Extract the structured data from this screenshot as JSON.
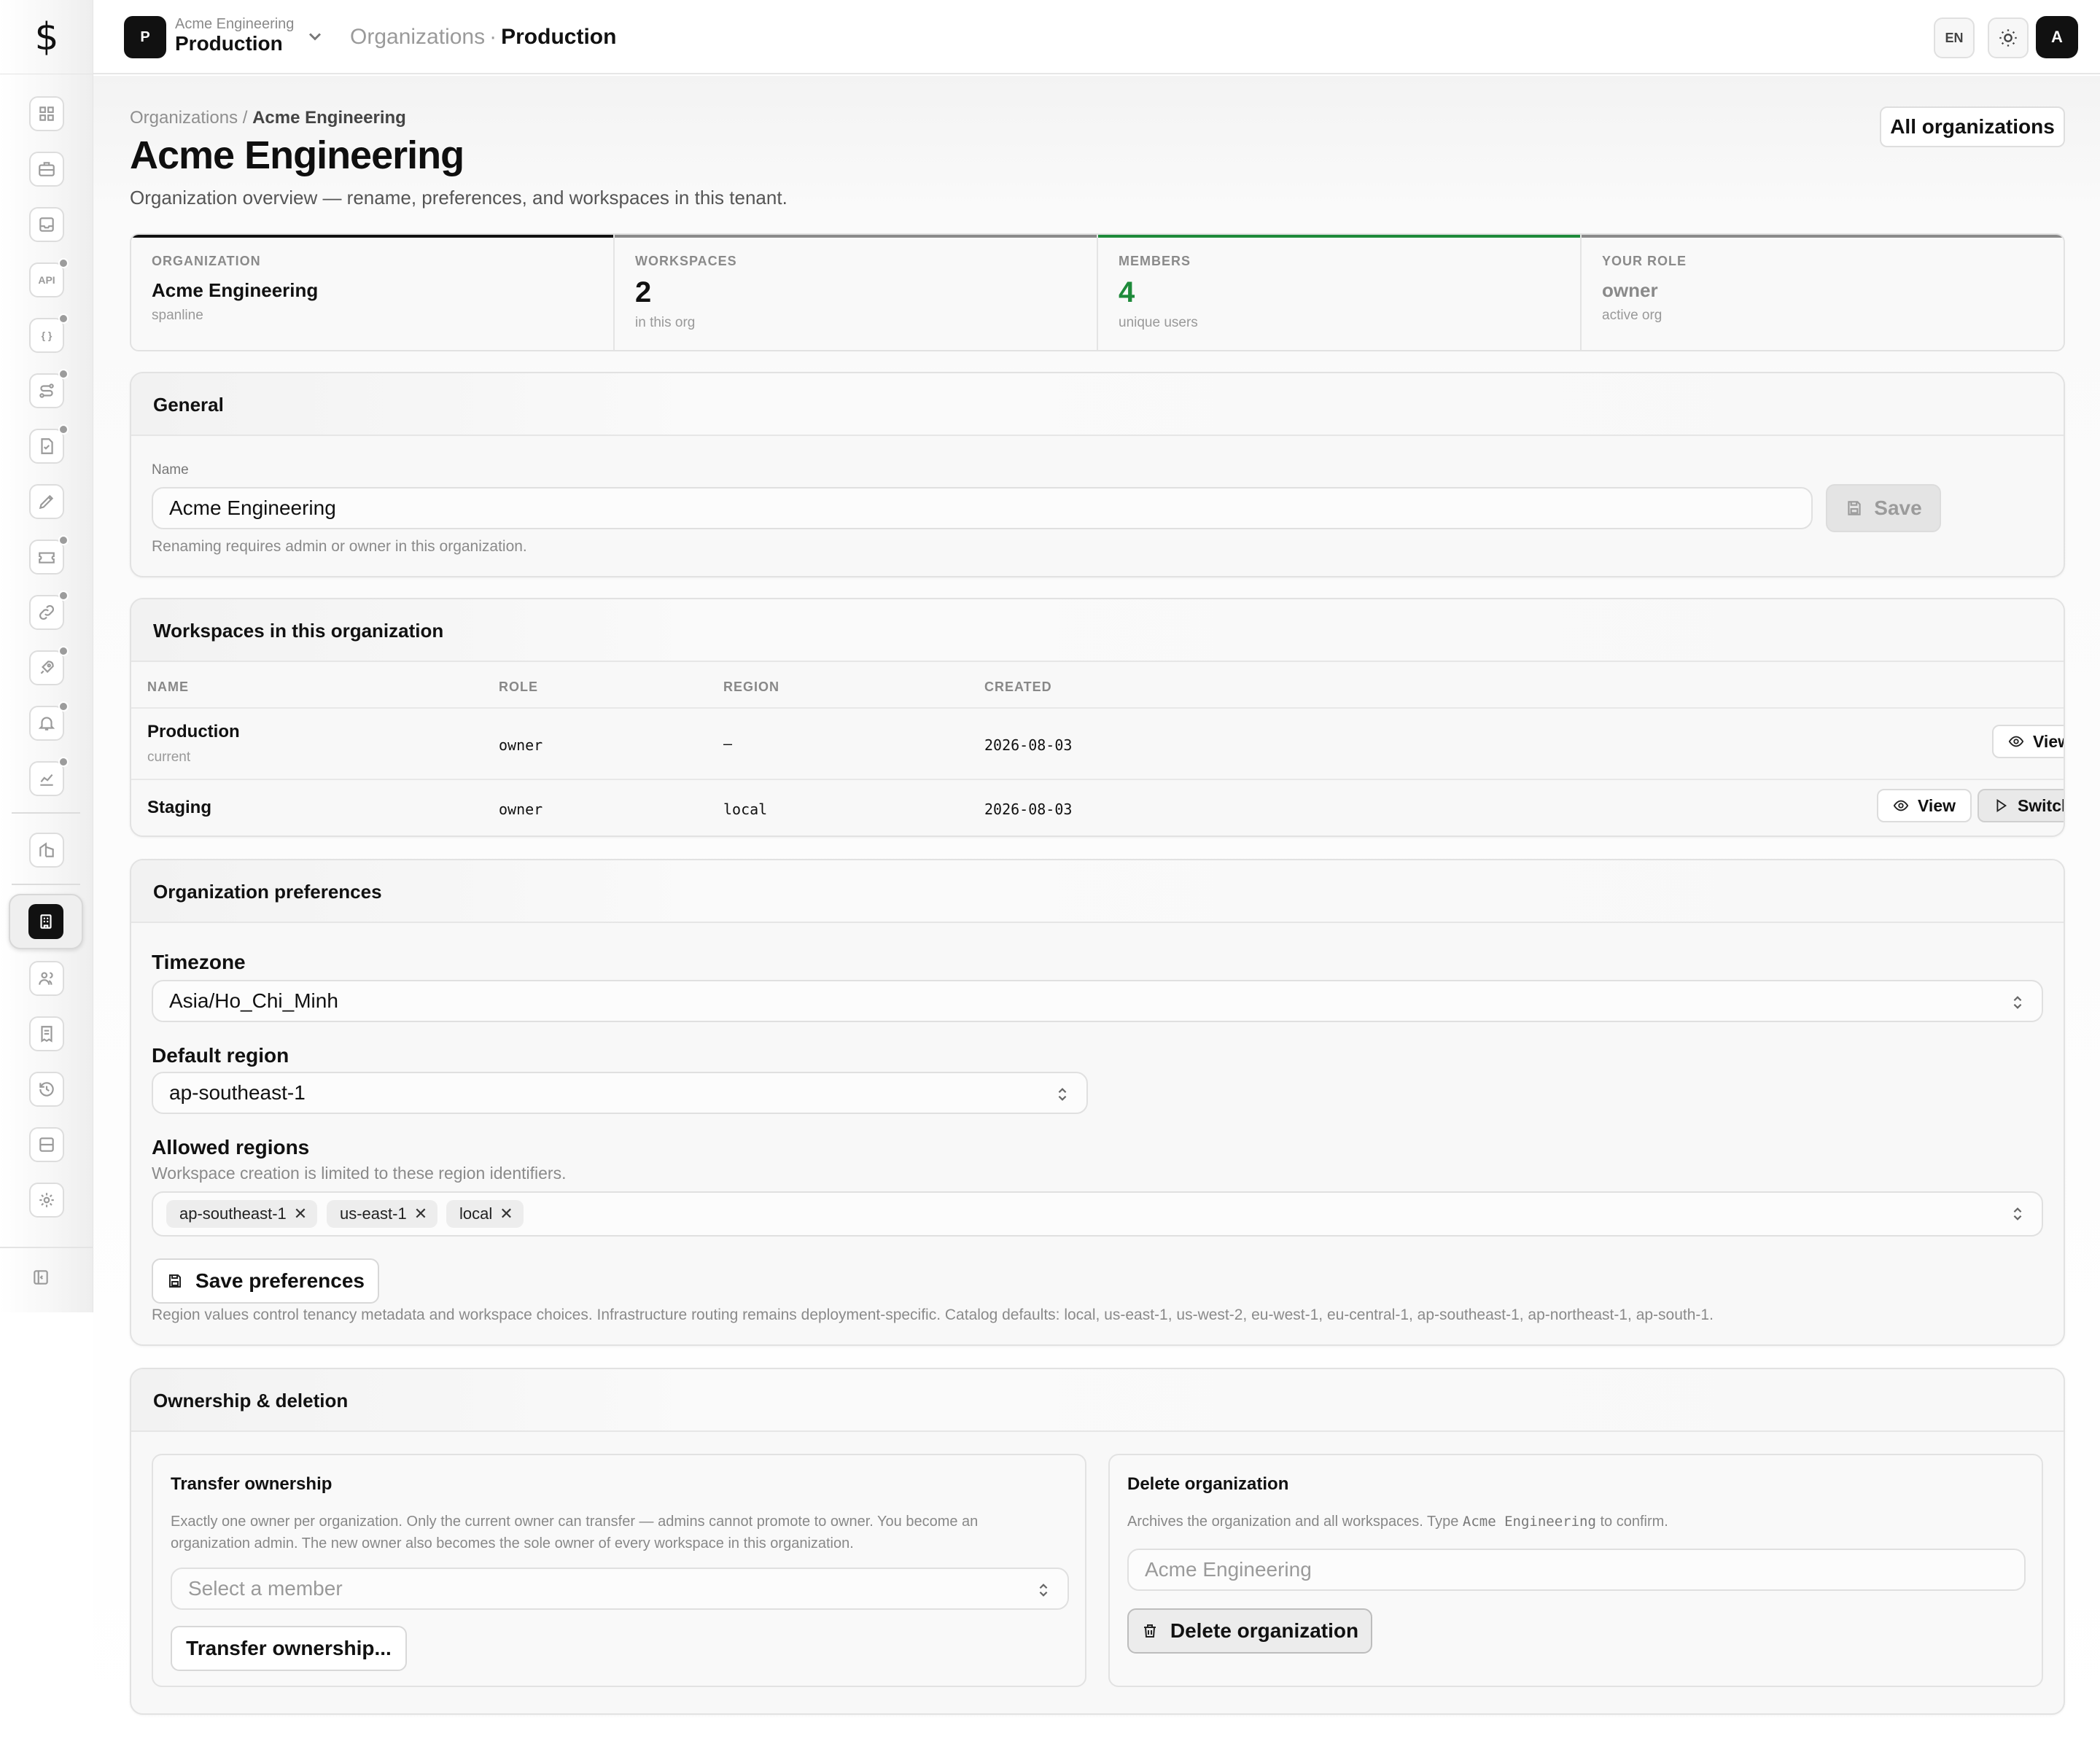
{
  "sidebar": {
    "logo": "$",
    "items": [
      {
        "icon": "dashboard-icon",
        "dot": false
      },
      {
        "icon": "briefcase-icon",
        "dot": false
      },
      {
        "icon": "inbox-icon",
        "dot": false
      },
      {
        "icon": "api-icon",
        "label": "API",
        "dot": true
      },
      {
        "icon": "braces-icon",
        "label": "{ }",
        "dot": true
      },
      {
        "icon": "route-icon",
        "dot": true
      },
      {
        "icon": "document-check-icon",
        "dot": true
      },
      {
        "icon": "pen-icon",
        "dot": false
      },
      {
        "icon": "ticket-icon",
        "dot": true
      },
      {
        "icon": "link-icon",
        "dot": true
      },
      {
        "icon": "rocket-icon",
        "dot": true
      },
      {
        "icon": "bell-icon",
        "dot": true
      },
      {
        "icon": "chart-icon",
        "dot": true
      },
      {
        "icon": "building-icon",
        "dot": false
      },
      {
        "icon": "organization-icon",
        "active": true
      },
      {
        "icon": "users-icon",
        "dot": false
      },
      {
        "icon": "receipt-icon",
        "dot": false
      },
      {
        "icon": "history-icon",
        "dot": false
      },
      {
        "icon": "storage-icon",
        "dot": false
      },
      {
        "icon": "settings-icon",
        "dot": false
      },
      {
        "icon": "collapse-sidebar-icon",
        "dot": false
      }
    ]
  },
  "topbar": {
    "workspace_avatar": "P",
    "workspace_org": "Acme Engineering",
    "workspace_name": "Production",
    "crumb_parent": "Organizations",
    "crumb_separator": "·",
    "crumb_current": "Production",
    "language": "EN",
    "user_initial": "A"
  },
  "page": {
    "breadcrumb_parent": "Organizations",
    "breadcrumb_separator": "/",
    "breadcrumb_current": "Acme Engineering",
    "title": "Acme Engineering",
    "subtitle": "Organization overview — rename, preferences, and workspaces in this tenant.",
    "all_orgs_button": "All organizations"
  },
  "stats": [
    {
      "label": "ORGANIZATION",
      "value": "Acme Engineering",
      "sub": "spanline",
      "accent": "#111111"
    },
    {
      "label": "WORKSPACES",
      "value": "2",
      "sub": "in this org",
      "accent": "#8a8a8a"
    },
    {
      "label": "MEMBERS",
      "value": "4",
      "sub": "unique users",
      "accent": "#1e8a3a"
    },
    {
      "label": "YOUR ROLE",
      "value": "owner",
      "sub": "active org",
      "accent": "#8a8a8a"
    }
  ],
  "general": {
    "title": "General",
    "name_label": "Name",
    "name_value": "Acme Engineering",
    "save_label": "Save",
    "hint": "Renaming requires admin or owner in this organization."
  },
  "workspaces": {
    "title": "Workspaces in this organization",
    "columns": [
      "NAME",
      "ROLE",
      "REGION",
      "CREATED"
    ],
    "rows": [
      {
        "name": "Production",
        "tag": "current",
        "role": "owner",
        "region": "—",
        "created": "2026-08-03",
        "view": "View"
      },
      {
        "name": "Staging",
        "tag": "",
        "role": "owner",
        "region": "local",
        "created": "2026-08-03",
        "view": "View",
        "switch": "Switch"
      }
    ]
  },
  "preferences": {
    "title": "Organization preferences",
    "timezone_label": "Timezone",
    "timezone_value": "Asia/Ho_Chi_Minh",
    "default_region_label": "Default region",
    "default_region_value": "ap-southeast-1",
    "allowed_regions_label": "Allowed regions",
    "allowed_regions_hint": "Workspace creation is limited to these region identifiers.",
    "allowed_regions": [
      "ap-southeast-1",
      "us-east-1",
      "local"
    ],
    "chip_remove": "✕",
    "save_label": "Save preferences",
    "footnote": "Region values control tenancy metadata and workspace choices. Infrastructure routing remains deployment-specific. Catalog defaults: local, us-east-1, us-west-2, eu-west-1, eu-central-1, ap-southeast-1, ap-northeast-1, ap-south-1."
  },
  "ownership": {
    "title": "Ownership & deletion",
    "transfer": {
      "title": "Transfer ownership",
      "text": "Exactly one owner per organization. Only the current owner can transfer — admins cannot promote to owner. You become an organization admin. The new owner also becomes the sole owner of every workspace in this organization.",
      "select_placeholder": "Select a member",
      "button": "Transfer ownership..."
    },
    "delete": {
      "title": "Delete organization",
      "text_before": "Archives the organization and all workspaces. Type ",
      "text_code": "Acme Engineering",
      "text_after": " to confirm.",
      "input_placeholder": "Acme Engineering",
      "button": "Delete organization"
    }
  }
}
